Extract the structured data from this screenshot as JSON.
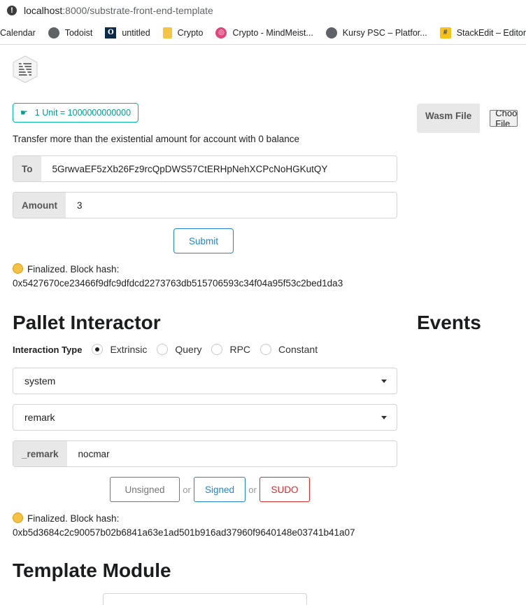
{
  "browser": {
    "url_host": "localhost",
    "url_path": ":8000/substrate-front-end-template",
    "bookmarks": [
      {
        "label": "Calendar",
        "icon": "none"
      },
      {
        "label": "Todoist",
        "icon": "globe-icon"
      },
      {
        "label": "untitled",
        "icon": "o-icon"
      },
      {
        "label": "Crypto",
        "icon": "folder-icon"
      },
      {
        "label": "Crypto - MindMeist...",
        "icon": "mindmeister-icon"
      },
      {
        "label": "Kursy PSC – Platfor...",
        "icon": "globe-icon"
      },
      {
        "label": "StackEdit – Editor",
        "icon": "stackedit-icon"
      }
    ]
  },
  "transfer": {
    "unit_badge": "1 Unit = 1000000000000",
    "hint": "Transfer more than the existential amount for account with 0 balance",
    "to_label": "To",
    "to_value": "5GrwvaEF5zXb26Fz9rcQpDWS57CtERHpNehXCPcNoHGKutQY",
    "amount_label": "Amount",
    "amount_value": "3",
    "submit_label": "Submit",
    "status_line1": "Finalized. Block hash:",
    "status_line2": "0x5427670ce23466f9dfc9dfdcd2273763db515706593c34f04a95f53c2bed1da3"
  },
  "wasm": {
    "label": "Wasm File",
    "choose_label": "Choose File"
  },
  "pallet": {
    "title": "Pallet Interactor",
    "interaction_label": "Interaction Type",
    "options": [
      "Extrinsic",
      "Query",
      "RPC",
      "Constant"
    ],
    "selected": "Extrinsic",
    "module_value": "system",
    "call_value": "remark",
    "param_label": "_remark",
    "param_value": "nocmar",
    "btn_unsigned": "Unsigned",
    "btn_or": "or",
    "btn_signed": "Signed",
    "btn_sudo": "SUDO",
    "status_line1": "Finalized. Block hash:",
    "status_line2": "0xb5d3684c2c90057b02b6841a63e1ad501b916ad37960f9640148e03741b41a07"
  },
  "events": {
    "title": "Events"
  },
  "template_module": {
    "title": "Template Module"
  },
  "colors": {
    "teal": "#00b5ad",
    "blue": "#2185d0",
    "red": "#db2828",
    "grey": "#767676"
  }
}
